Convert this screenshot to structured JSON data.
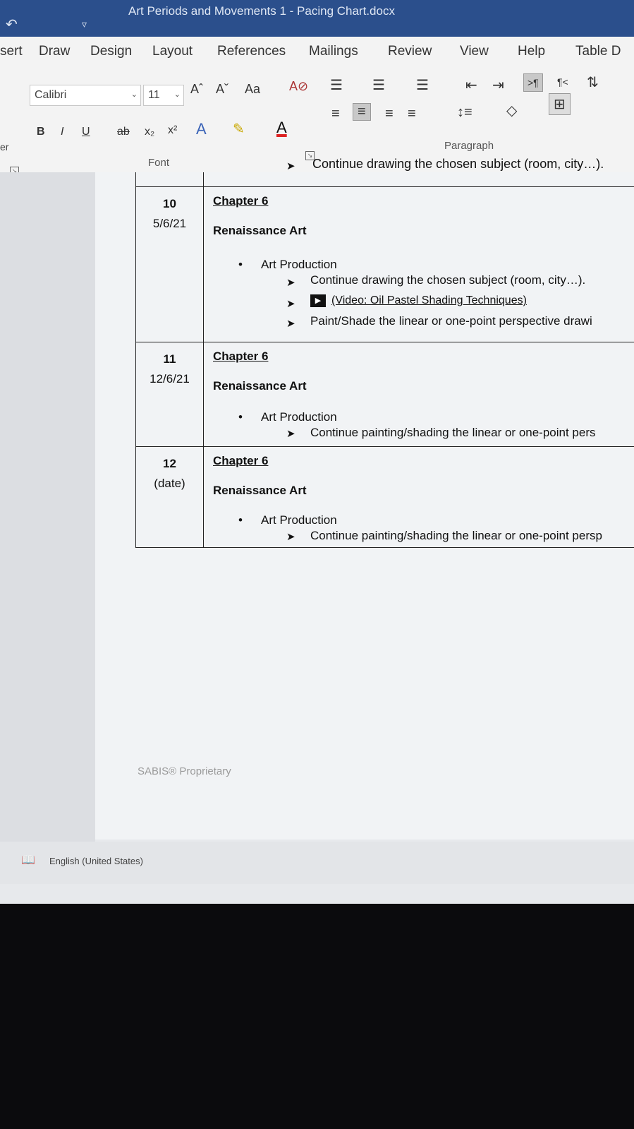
{
  "window": {
    "title": "Art Periods and Movements 1 - Pacing Chart.docx"
  },
  "ribbon_tabs": [
    "sert",
    "Draw",
    "Design",
    "Layout",
    "References",
    "Mailings",
    "Review",
    "View",
    "Help",
    "Table D"
  ],
  "font_group": {
    "font_name": "Calibri",
    "font_size": "11",
    "label": "Font",
    "buttons": {
      "grow": "Aˆ",
      "shrink": "Aˇ",
      "case": "Aa",
      "bold": "B",
      "italic": "I",
      "underline": "U",
      "strike": "ab",
      "subscript": "x₂",
      "superscript": "x²"
    }
  },
  "paragraph_group": {
    "label": "Paragraph"
  },
  "left_pane": {
    "fragment": "er"
  },
  "document": {
    "top_fragment": "Continue drawing the chosen subject (room, city…).",
    "rows": [
      {
        "number": "10",
        "date": "5/6/21",
        "chapter": "Chapter 6",
        "subject": "Renaissance Art",
        "bullet": "Art Production",
        "items": [
          "Continue drawing the chosen subject (room, city…).",
          "(Video: Oil Pastel Shading Techniques)",
          "Paint/Shade the linear or one-point perspective drawi"
        ]
      },
      {
        "number": "11",
        "date": "12/6/21",
        "chapter": "Chapter 6",
        "subject": "Renaissance Art",
        "bullet": "Art Production",
        "items": [
          "Continue painting/shading the linear or one-point pers"
        ]
      },
      {
        "number": "12",
        "date": "(date)",
        "chapter": "Chapter 6",
        "subject": "Renaissance Art",
        "bullet": "Art Production",
        "items": [
          "Continue painting/shading the linear or one-point persp"
        ]
      }
    ],
    "footer": "SABIS® Proprietary"
  },
  "status_bar": {
    "language": "English (United States)"
  },
  "colors": {
    "title_bar": "#2b4f8c",
    "ribbon": "#f3f3f3",
    "page": "#f1f3f5"
  }
}
